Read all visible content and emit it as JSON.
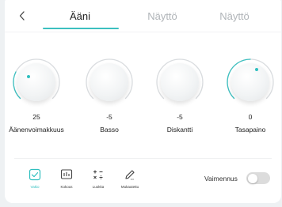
{
  "tabs": [
    {
      "label": "Ääni",
      "active": true
    },
    {
      "label": "Näyttö",
      "active": false
    },
    {
      "label": "Näyttö",
      "active": false
    }
  ],
  "knobs": [
    {
      "value": "25",
      "label": "Äänenvoimakkuus"
    },
    {
      "value": "-5",
      "label": "Basso"
    },
    {
      "value": "-5",
      "label": "Diskantti"
    },
    {
      "value": "0",
      "label": "Tasapaino"
    }
  ],
  "presets": [
    {
      "label": "Vakio",
      "icon": "check-icon",
      "active": true
    },
    {
      "label": "Kokous",
      "icon": "meeting-icon",
      "active": false
    },
    {
      "label": "Luokka",
      "icon": "classroom-icon",
      "active": false
    },
    {
      "label": "Mukautettu",
      "icon": "custom-icon",
      "active": false
    }
  ],
  "mute": {
    "label": "Vaimennus",
    "on": false
  },
  "colors": {
    "accent": "#3cc0c0",
    "track": "#d9dcdf"
  }
}
